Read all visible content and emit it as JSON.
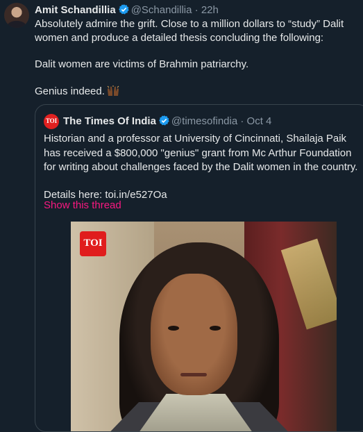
{
  "tweet": {
    "author_name": "Amit Schandillia",
    "handle": "@Schandillia",
    "time": "22h",
    "paragraphs": [
      "Absolutely admire the grift. Close to a million dollars to “study” Dalit women and produce a detailed thesis concluding the following:",
      "Dalit women are victims of Brahmin patriarchy.",
      "Genius indeed."
    ],
    "emoji": "raised-hands-emoji"
  },
  "quote": {
    "author_name": "The Times Of India",
    "handle": "@timesofindia",
    "date": "Oct 4",
    "logo_text": "TOI",
    "paragraphs": [
      "Historian and a professor at University of Cincinnati, Shailaja Paik has received a $800,000 \"genius\" grant from Mc Arthur Foundation for writing about challenges faced by the Dalit women in the country.",
      "Details here: toi.in/e527Oa"
    ],
    "show_thread": "Show this thread",
    "media_badge": "TOI"
  },
  "separator": "·",
  "colors": {
    "background": "#15202b",
    "text": "#e7e9ea",
    "muted": "#8b98a5",
    "verified": "#1d9bf0",
    "link": "#f91880",
    "toi_red": "#e01d1d"
  }
}
